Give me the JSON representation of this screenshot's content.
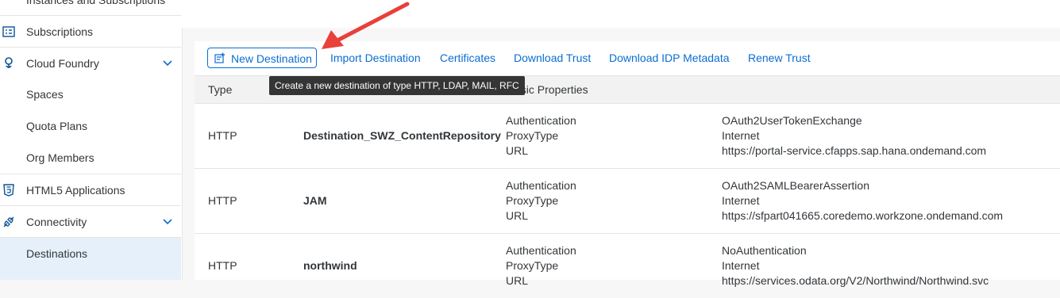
{
  "sidebar": {
    "items": [
      {
        "label": "Instances and Subscriptions",
        "icon": "none"
      },
      {
        "label": "Subscriptions",
        "icon": "list-icon"
      },
      {
        "label": "Cloud Foundry",
        "icon": "cloud-foundry-icon",
        "expanded": true
      },
      {
        "label": "Spaces"
      },
      {
        "label": "Quota Plans"
      },
      {
        "label": "Org Members"
      },
      {
        "label": "HTML5 Applications",
        "icon": "html5-icon"
      },
      {
        "label": "Connectivity",
        "icon": "connectivity-icon",
        "expanded": true
      },
      {
        "label": "Destinations",
        "selected": true
      }
    ]
  },
  "toolbar": {
    "new_destination": "New Destination",
    "import_destination": "Import Destination",
    "certificates": "Certificates",
    "download_trust": "Download Trust",
    "download_idp_metadata": "Download IDP Metadata",
    "renew_trust": "Renew Trust"
  },
  "tooltip": "Create a new destination of type HTTP, LDAP, MAIL, RFC",
  "table": {
    "headers": {
      "type": "Type",
      "basic_properties": "asic Properties"
    },
    "rows": [
      {
        "type": "HTTP",
        "name": "Destination_SWZ_ContentRepository",
        "keys": [
          "Authentication",
          "ProxyType",
          "URL"
        ],
        "values": [
          "OAuth2UserTokenExchange",
          "Internet",
          "https://portal-service.cfapps.sap.hana.ondemand.com"
        ]
      },
      {
        "type": "HTTP",
        "name": "JAM",
        "keys": [
          "Authentication",
          "ProxyType",
          "URL"
        ],
        "values": [
          "OAuth2SAMLBearerAssertion",
          "Internet",
          "https://sfpart041665.coredemo.workzone.ondemand.com"
        ]
      },
      {
        "type": "HTTP",
        "name": "northwind",
        "keys": [
          "Authentication",
          "ProxyType",
          "URL"
        ],
        "values": [
          "NoAuthentication",
          "Internet",
          "https://services.odata.org/V2/Northwind/Northwind.svc"
        ]
      }
    ]
  },
  "colors": {
    "accent": "#0a6ed1",
    "arrow": "#e8403a",
    "selected_bg": "#e5f0fa"
  }
}
